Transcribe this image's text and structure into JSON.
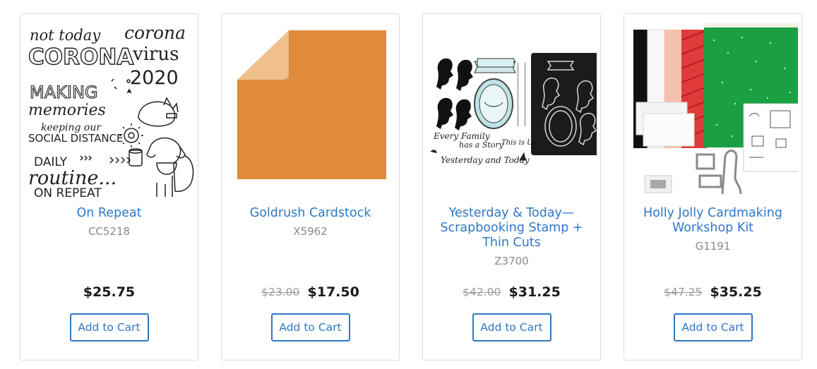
{
  "products": [
    {
      "image_alt": "",
      "image_text": [
        "not today",
        "CORONA",
        "corona",
        "virus",
        "2020",
        "MAKING",
        "memories",
        "keeping our",
        "SOCIAL DISTANCE",
        "DAILY",
        "routine...",
        "ON REPEAT"
      ],
      "title": "On Repeat",
      "sku": "CC5218",
      "old_price": "",
      "price": "$25.75",
      "button_label": "Add to Cart"
    },
    {
      "image_alt": "",
      "title": "Goldrush Cardstock",
      "sku": "X5962",
      "old_price": "$23.00",
      "price": "$17.50",
      "button_label": "Add to Cart",
      "swatch_color": "#df8b3a",
      "fold_color": "#efc08c"
    },
    {
      "image_alt": "",
      "image_text": [
        "Every Family",
        "has a Story",
        "This is US",
        "Yesterday and Today"
      ],
      "title": "Yesterday & Today—Scrapbooking Stamp + Thin Cuts",
      "sku": "Z3700",
      "old_price": "$42.00",
      "price": "$31.25",
      "button_label": "Add to Cart"
    },
    {
      "image_alt": "",
      "title": "Holly Jolly Cardmaking Workshop Kit",
      "sku": "G1191",
      "old_price": "$47.25",
      "price": "$35.25",
      "button_label": "Add to Cart"
    }
  ],
  "colors": {
    "link": "#2f77c6",
    "price": "#1a1a1a",
    "muted": "#8a8a8a",
    "border": "#dcdcdc"
  }
}
